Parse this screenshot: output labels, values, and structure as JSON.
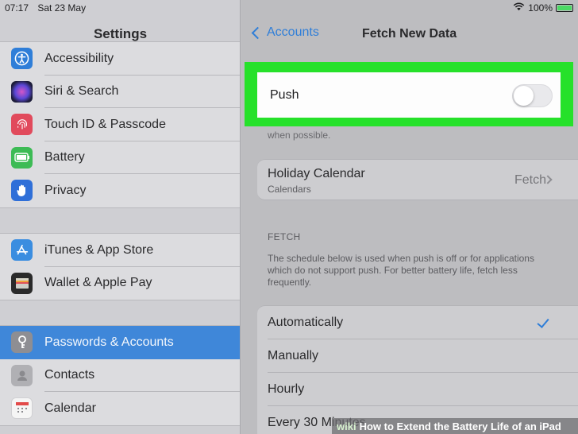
{
  "status": {
    "time": "07:17",
    "date": "Sat 23 May",
    "battery": "100%"
  },
  "left": {
    "title": "Settings",
    "groups": [
      {
        "items": [
          {
            "label": "Accessibility",
            "icon": "accessibility-icon",
            "color": "#2f7ed8"
          },
          {
            "label": "Siri & Search",
            "icon": "siri-icon",
            "color": "#2b2b5e"
          },
          {
            "label": "Touch ID & Passcode",
            "icon": "fingerprint-icon",
            "color": "#e14a5c"
          },
          {
            "label": "Battery",
            "icon": "battery-icon",
            "color": "#3dbb55"
          },
          {
            "label": "Privacy",
            "icon": "hand-icon",
            "color": "#2f6fd8"
          }
        ]
      },
      {
        "items": [
          {
            "label": "iTunes & App Store",
            "icon": "app-store-icon",
            "color": "#3a8de0"
          },
          {
            "label": "Wallet & Apple Pay",
            "icon": "wallet-icon",
            "color": "#2a2a2a"
          }
        ]
      },
      {
        "items": [
          {
            "label": "Passwords & Accounts",
            "icon": "key-icon",
            "color": "#8e8e93",
            "selected": true
          },
          {
            "label": "Contacts",
            "icon": "contacts-icon",
            "color": "#b0b0b4"
          },
          {
            "label": "Calendar",
            "icon": "calendar-icon",
            "color": "#f5f5f5"
          }
        ]
      }
    ]
  },
  "right": {
    "back_label": "Accounts",
    "title": "Fetch New Data",
    "push_label": "Push",
    "push_enabled": false,
    "push_footer": "when possible.",
    "holiday": {
      "title": "Holiday Calendar",
      "subtitle": "Calendars",
      "value": "Fetch"
    },
    "fetch_header": "FETCH",
    "fetch_description": "The schedule below is used when push is off or for applications which do not support push. For better battery life, fetch less frequently.",
    "options": [
      {
        "label": "Automatically",
        "selected": true
      },
      {
        "label": "Manually",
        "selected": false
      },
      {
        "label": "Hourly",
        "selected": false
      },
      {
        "label": "Every 30 Minutes",
        "selected": false
      }
    ]
  },
  "watermark": {
    "brand": "wiki",
    "text": "How to Extend the Battery Life of an iPad"
  },
  "colors": {
    "accent": "#2f7ed8",
    "highlight": "#26e12a",
    "selected_row": "#3f87d9"
  }
}
